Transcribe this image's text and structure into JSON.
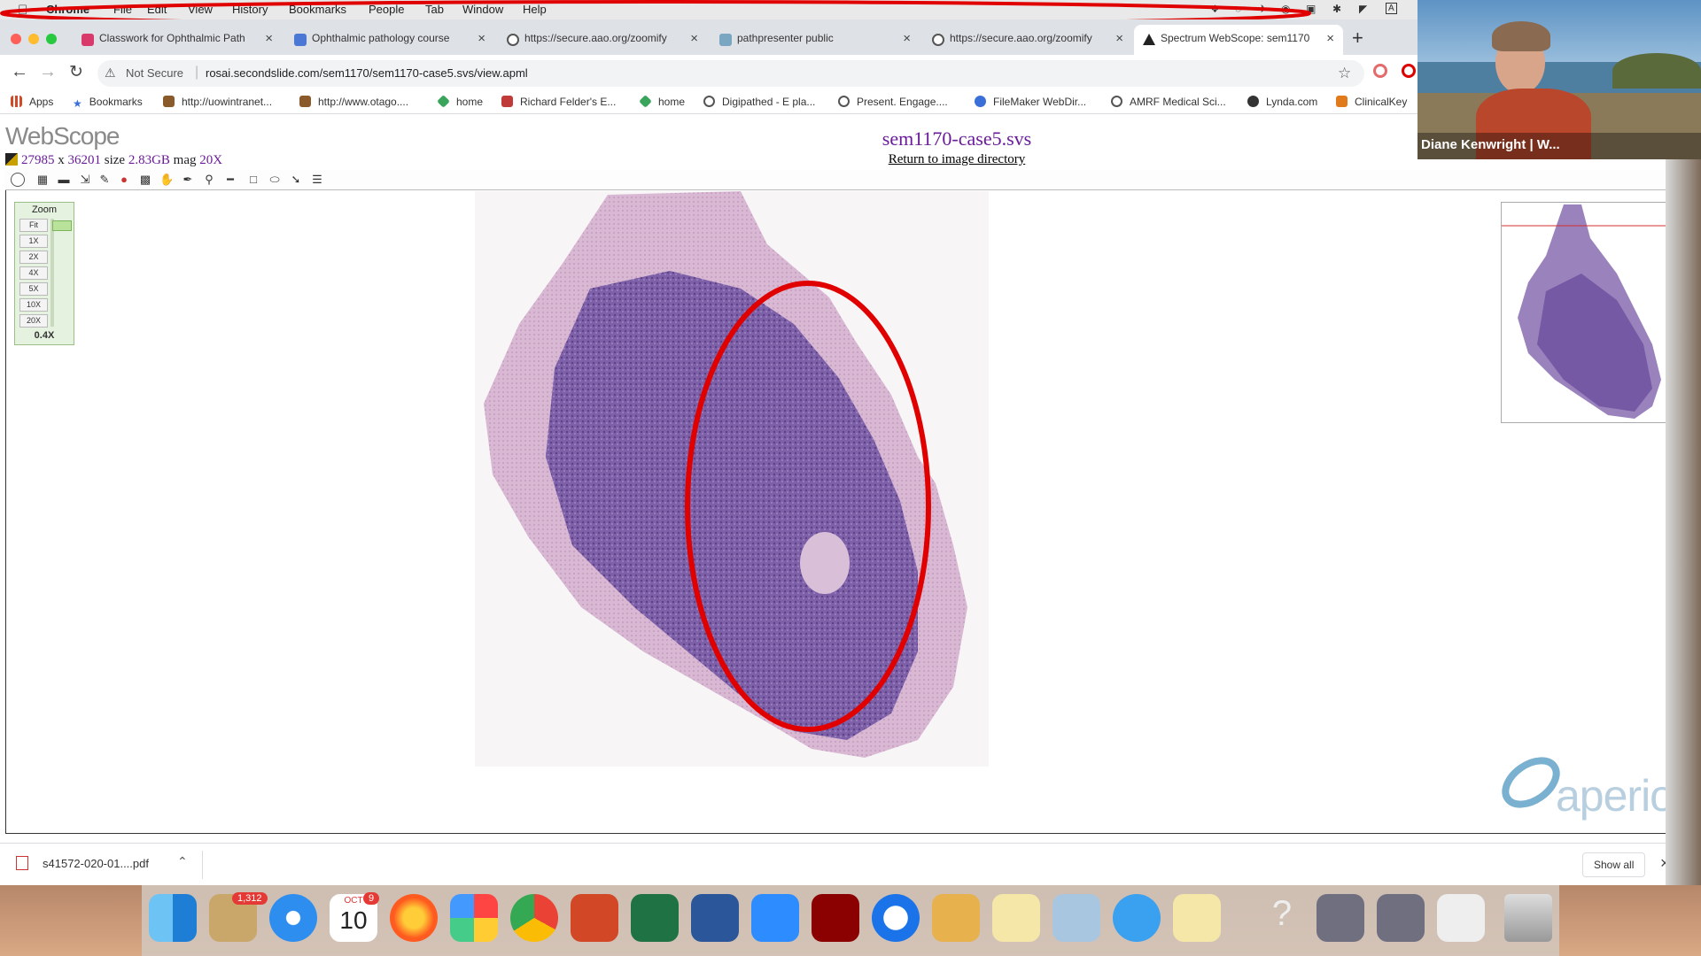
{
  "menubar": {
    "app_name": "Chrome",
    "items": [
      "File",
      "Edit",
      "View",
      "History",
      "Bookmarks",
      "People",
      "Tab",
      "Window",
      "Help"
    ]
  },
  "tabs": [
    {
      "title": "Classwork for Ophthalmic Path",
      "color": "#d93a6b",
      "active": false
    },
    {
      "title": "Ophthalmic pathology course",
      "color": "#4a78d4",
      "active": false
    },
    {
      "title": "https://secure.aao.org/zoomify",
      "color": "#555555",
      "active": false
    },
    {
      "title": "pathpresenter public",
      "color": "#7aa6c2",
      "active": false
    },
    {
      "title": "https://secure.aao.org/zoomify",
      "color": "#555555",
      "active": false
    },
    {
      "title": "Spectrum WebScope: sem1170",
      "color": "#222222",
      "active": true
    }
  ],
  "toolbar": {
    "security_label": "Not Secure",
    "url": "rosai.secondslide.com/sem1170/sem1170-case5.svs/view.apml"
  },
  "bookmarks": [
    {
      "label": "Apps",
      "color": "#d04a2a"
    },
    {
      "label": "Bookmarks",
      "color": "#3a6fd8"
    },
    {
      "label": "http://uowintranet...",
      "color": "#8a5a2a"
    },
    {
      "label": "http://www.otago....",
      "color": "#8a5a2a"
    },
    {
      "label": "home",
      "color": "#3aa55a"
    },
    {
      "label": "Richard Felder's E...",
      "color": "#c03a3a"
    },
    {
      "label": "home",
      "color": "#3aa55a"
    },
    {
      "label": "Digipathed - E pla...",
      "color": "#555555"
    },
    {
      "label": "Present. Engage....",
      "color": "#555555"
    },
    {
      "label": "FileMaker WebDir...",
      "color": "#3a6fd8"
    },
    {
      "label": "AMRF Medical Sci...",
      "color": "#555555"
    },
    {
      "label": "Lynda.com",
      "color": "#333333"
    },
    {
      "label": "ClinicalKey",
      "color": "#e07a1a"
    }
  ],
  "webscope": {
    "logo": "WebScope",
    "width_px": "27985",
    "x": "x",
    "height_px": "36201",
    "size_label": "size",
    "size_value": "2.83GB",
    "mag_label": "mag",
    "mag_value": "20X",
    "image_title": "sem1170-case5.svs",
    "return_link": "Return to image directory",
    "zoom_title": "Zoom",
    "zoom_buttons": [
      "Fit",
      "1X",
      "2X",
      "4X",
      "5X",
      "10X",
      "20X"
    ],
    "zoom_current": "0.4X",
    "brand": "aperio"
  },
  "download": {
    "filename": "s41572-020-01....pdf",
    "show_all": "Show all"
  },
  "video": {
    "participant": "Diane Kenwright | W..."
  },
  "dock": {
    "mail_badge": "1,312",
    "calendar_month": "OCT",
    "calendar_day": "10",
    "calendar_badge": "9"
  }
}
